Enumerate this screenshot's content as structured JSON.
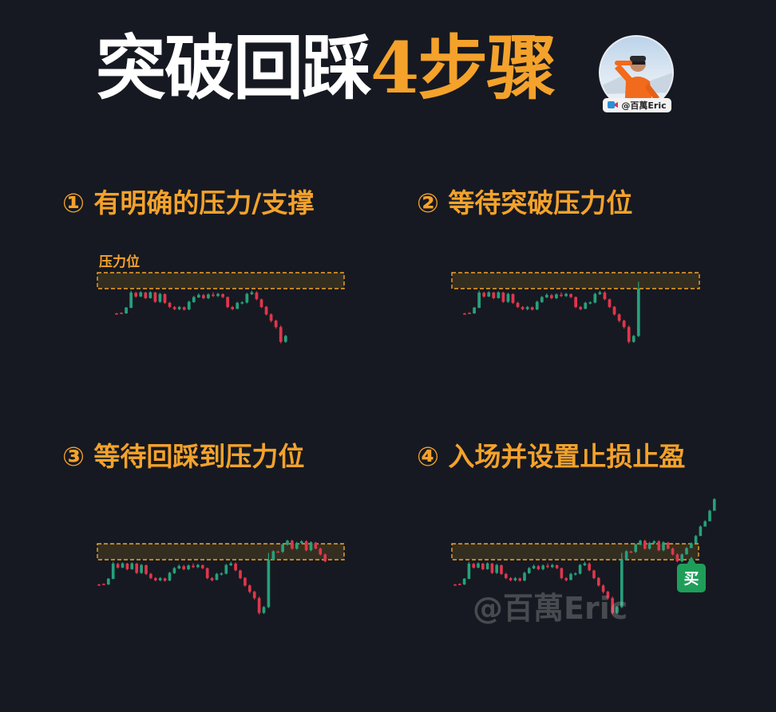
{
  "header": {
    "title_white": "突破回踩",
    "title_orange": "4步骤",
    "badge_text": "@百萬Eric"
  },
  "colors": {
    "background": "#161921",
    "accent": "#f4a22b",
    "bull": "#26a17b",
    "bear": "#e0364d",
    "zone_fill": "#3a3220",
    "zone_border": "#f4a22b",
    "buy_tag": "#1f9e5a"
  },
  "steps": [
    {
      "label": "① 有明确的压力/支撑",
      "zone_label": "压力位"
    },
    {
      "label": "② 等待突破压力位"
    },
    {
      "label": "③ 等待回踩到压力位"
    },
    {
      "label": "④ 入场并设置止损止盈",
      "buy_label": "买"
    }
  ],
  "watermark": "@百萬Eric",
  "chart_data": {
    "type": "candlestick",
    "base_series": [
      [
        0.94,
        0.96,
        0.99,
        0.92
      ],
      [
        0.92,
        0.94,
        0.96,
        0.9
      ],
      [
        0.94,
        0.72,
        0.96,
        0.7
      ],
      [
        0.73,
        0.15,
        0.74,
        0.08
      ],
      [
        0.16,
        0.3,
        0.34,
        0.12
      ],
      [
        0.3,
        0.14,
        0.32,
        0.1
      ],
      [
        0.15,
        0.36,
        0.4,
        0.12
      ],
      [
        0.36,
        0.14,
        0.38,
        0.1
      ],
      [
        0.15,
        0.5,
        0.54,
        0.12
      ],
      [
        0.5,
        0.2,
        0.54,
        0.16
      ],
      [
        0.21,
        0.54,
        0.58,
        0.18
      ],
      [
        0.54,
        0.7,
        0.74,
        0.5
      ],
      [
        0.7,
        0.78,
        0.82,
        0.66
      ],
      [
        0.78,
        0.7,
        0.82,
        0.66
      ],
      [
        0.71,
        0.8,
        0.83,
        0.68
      ],
      [
        0.79,
        0.5,
        0.82,
        0.46
      ],
      [
        0.51,
        0.32,
        0.54,
        0.28
      ],
      [
        0.33,
        0.24,
        0.36,
        0.18
      ],
      [
        0.25,
        0.36,
        0.4,
        0.2
      ],
      [
        0.36,
        0.22,
        0.4,
        0.18
      ],
      [
        0.23,
        0.28,
        0.32,
        0.14
      ],
      [
        0.28,
        0.2,
        0.32,
        0.16
      ],
      [
        0.21,
        0.32,
        0.36,
        0.18
      ],
      [
        0.32,
        0.7,
        0.74,
        0.3
      ],
      [
        0.7,
        0.78,
        0.82,
        0.66
      ],
      [
        0.77,
        0.54,
        0.78,
        0.5
      ],
      [
        0.55,
        0.52,
        0.6,
        0.48
      ],
      [
        0.53,
        0.2,
        0.56,
        0.16
      ],
      [
        0.21,
        0.14,
        0.24,
        0.08
      ],
      [
        0.15,
        0.4,
        0.44,
        0.1
      ],
      [
        0.41,
        0.7,
        0.74,
        0.38
      ],
      [
        0.69,
        0.98,
        1.02,
        0.66
      ],
      [
        0.98,
        1.22,
        1.28,
        0.94
      ],
      [
        1.22,
        1.46,
        1.52,
        1.18
      ],
      [
        1.46,
        2.02,
        2.08,
        1.4
      ],
      [
        2.02,
        1.8,
        2.06,
        1.76
      ]
    ],
    "step2_extra": [
      [
        1.8,
        0.0,
        1.84,
        -0.26
      ]
    ],
    "step3_extra": [
      [
        0.0,
        -0.32,
        0.02,
        -0.36
      ],
      [
        -0.31,
        -0.3,
        -0.26,
        -0.34
      ],
      [
        -0.3,
        -0.58,
        -0.26,
        -0.62
      ],
      [
        -0.57,
        -0.72,
        -0.54,
        -0.76
      ],
      [
        -0.72,
        -0.42,
        -0.38,
        -0.76
      ],
      [
        -0.42,
        -0.64,
        -0.38,
        -0.68
      ],
      [
        -0.63,
        -0.7,
        -0.6,
        -0.74
      ],
      [
        -0.7,
        -0.36,
        -0.32,
        -0.74
      ],
      [
        -0.36,
        -0.66,
        -0.32,
        -0.7
      ],
      [
        -0.65,
        -0.42,
        -0.4,
        -0.68
      ],
      [
        -0.42,
        -0.2,
        -0.16,
        -0.46
      ],
      [
        -0.2,
        0.06,
        0.1,
        -0.24
      ]
    ],
    "step4_extra": [
      [
        0.06,
        -0.2,
        0.1,
        -0.24
      ],
      [
        -0.2,
        -0.44,
        -0.4,
        -0.48
      ],
      [
        -0.44,
        -0.62,
        -0.58,
        -0.66
      ],
      [
        -0.62,
        -0.9,
        -0.86,
        -0.94
      ],
      [
        -0.9,
        -1.26,
        -1.22,
        -1.3
      ],
      [
        -1.26,
        -1.46,
        -1.42,
        -1.5
      ],
      [
        -1.46,
        -1.86,
        -1.82,
        -1.9
      ],
      [
        -1.86,
        -2.3,
        -2.26,
        -2.34
      ]
    ]
  }
}
